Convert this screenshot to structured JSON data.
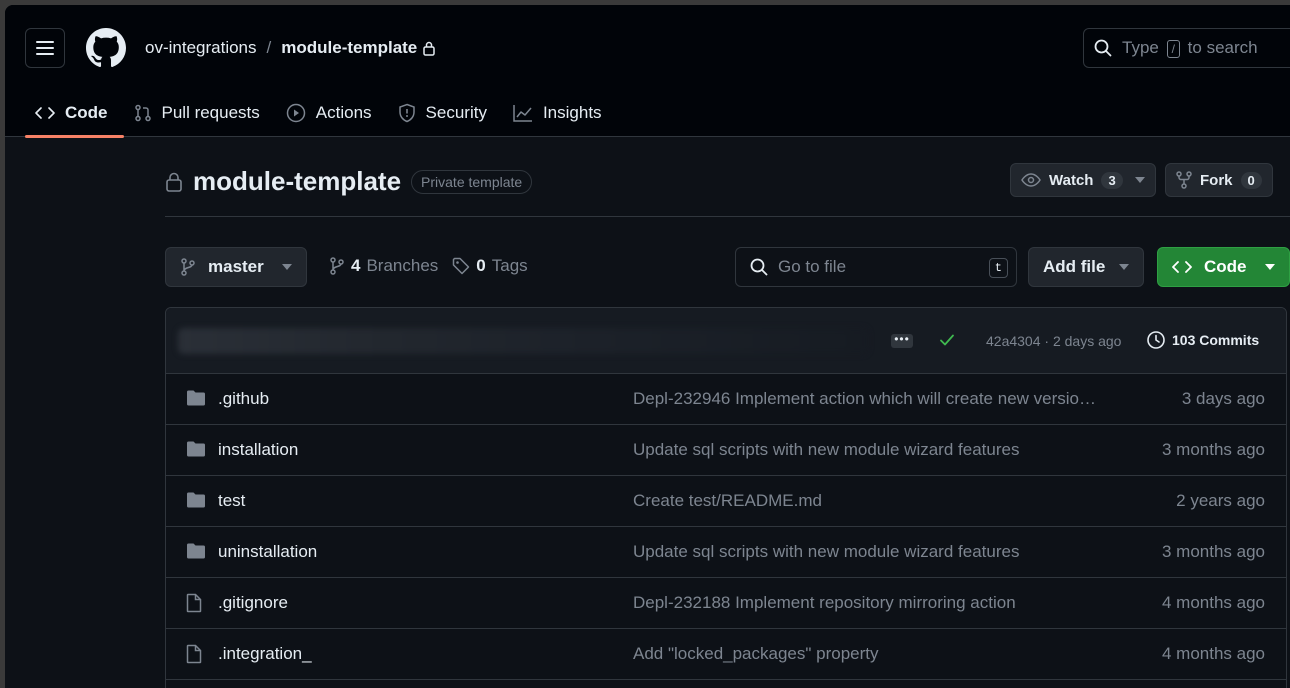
{
  "header": {
    "owner": "ov-integrations",
    "separator": "/",
    "repo": "module-template",
    "search_prefix": "Type",
    "search_key": "/",
    "search_suffix": "to search"
  },
  "tabs": [
    {
      "label": "Code",
      "icon": "code-icon",
      "active": true
    },
    {
      "label": "Pull requests",
      "icon": "pull-request-icon"
    },
    {
      "label": "Actions",
      "icon": "play-icon"
    },
    {
      "label": "Security",
      "icon": "shield-icon"
    },
    {
      "label": "Insights",
      "icon": "graph-icon"
    }
  ],
  "repo_header": {
    "name": "module-template",
    "badge": "Private template",
    "watch_label": "Watch",
    "watch_count": "3",
    "fork_label": "Fork",
    "fork_count": "0"
  },
  "toolbar": {
    "branch": "master",
    "branches_count": "4",
    "branches_label": "Branches",
    "tags_count": "0",
    "tags_label": "Tags",
    "gofile_placeholder": "Go to file",
    "gofile_key": "t",
    "add_file": "Add file",
    "code": "Code"
  },
  "commit_bar": {
    "sha_time": "42a4304 · 2 days ago",
    "commits": "103 Commits"
  },
  "files": [
    {
      "type": "folder",
      "name": ".github",
      "message": "Depl-232946 Implement action which will create new versio…",
      "age": "3 days ago"
    },
    {
      "type": "folder",
      "name": "installation",
      "message": "Update sql scripts with new module wizard features",
      "age": "3 months ago"
    },
    {
      "type": "folder",
      "name": "test",
      "message": "Create test/README.md",
      "age": "2 years ago"
    },
    {
      "type": "folder",
      "name": "uninstallation",
      "message": "Update sql scripts with new module wizard features",
      "age": "3 months ago"
    },
    {
      "type": "file",
      "name": ".gitignore",
      "message": "Depl-232188 Implement repository mirroring action",
      "age": "4 months ago"
    },
    {
      "type": "file",
      "name": ".integration_",
      "message": "Add \"locked_packages\" property",
      "age": "4 months ago"
    }
  ],
  "colors": {
    "accent_tab": "#f78166",
    "code_button": "#238636",
    "check": "#3fb950"
  }
}
